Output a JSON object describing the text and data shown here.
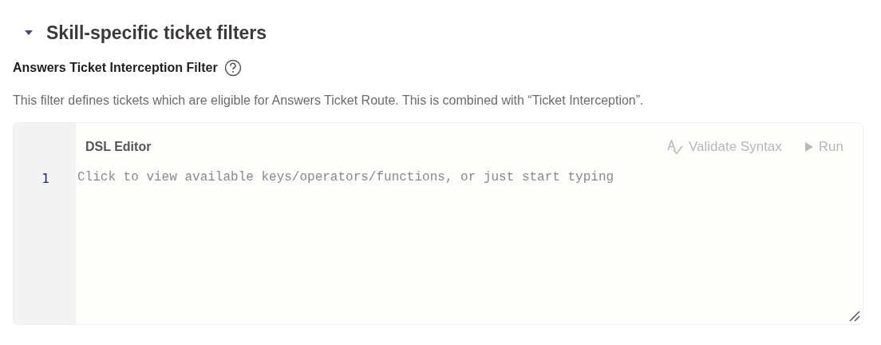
{
  "section": {
    "title": "Skill-specific ticket filters",
    "expanded": true
  },
  "filter": {
    "label": "Answers Ticket Interception Filter",
    "description": "This filter defines tickets which are eligible for Answers Ticket Route. This is combined with “Ticket Interception”."
  },
  "editor": {
    "title": "DSL Editor",
    "actions": [
      {
        "kind": "validate",
        "label": "Validate Syntax",
        "disabled": true
      },
      {
        "kind": "run",
        "label": "Run",
        "disabled": true
      }
    ],
    "line_numbers": [
      "1"
    ],
    "placeholder": "Click to view available keys/operators/functions, or just start typing"
  }
}
